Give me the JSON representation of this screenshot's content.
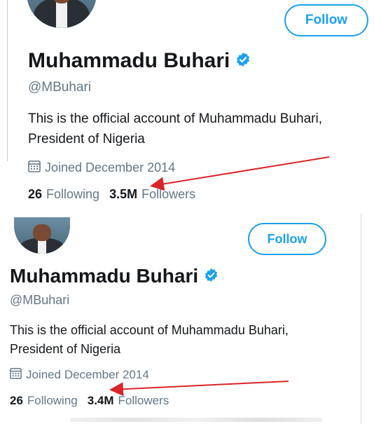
{
  "profiles": [
    {
      "follow_label": "Follow",
      "name": "Muhammadu Buhari",
      "handle": "@MBuhari",
      "bio_line1": "This is the official account of Muhammadu Buhari,",
      "bio_line2": "President of Nigeria",
      "joined": "Joined December 2014",
      "following_count": "26",
      "following_label": "Following",
      "followers_count": "3.5M",
      "followers_label": "Followers"
    },
    {
      "follow_label": "Follow",
      "name": "Muhammadu Buhari",
      "handle": "@MBuhari",
      "bio_line1": "This is the official account of Muhammadu Buhari,",
      "bio_line2": "President of Nigeria",
      "joined": "Joined December 2014",
      "following_count": "26",
      "following_label": "Following",
      "followers_count": "3.4M",
      "followers_label": "Followers"
    }
  ],
  "colors": {
    "accent": "#1da1f2",
    "secondary_text": "#657786",
    "annotation_arrow": "#d9252a"
  },
  "icons": [
    "verified-badge-icon",
    "calendar-icon",
    "annotation-arrow"
  ]
}
